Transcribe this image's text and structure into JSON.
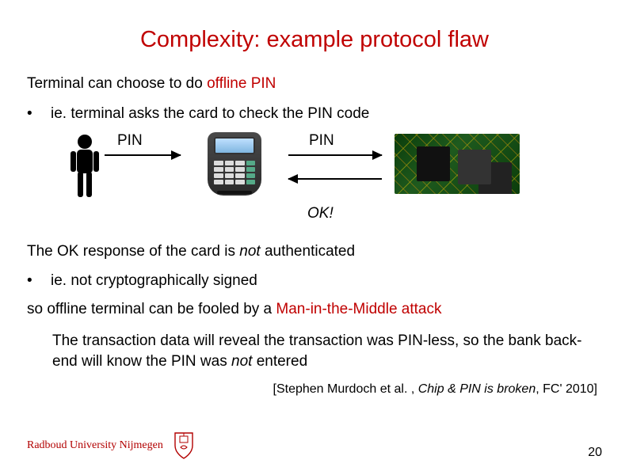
{
  "title": "Complexity: example protocol flaw",
  "line1_a": "Terminal can choose to do ",
  "line1_b": "offline PIN",
  "bullet1": "ie. terminal asks the card to check the PIN code",
  "diagram": {
    "pin_a": "PIN",
    "pin_b": "PIN",
    "ok": "OK!"
  },
  "line2_a": "The OK response of the card is ",
  "line2_not": "not",
  "line2_b": "  authenticated",
  "bullet2": "ie. not cryptographically signed",
  "line3_a": "so offline terminal can be fooled by a ",
  "line3_b": "Man-in-the-Middle attack",
  "line4_a": "The transaction data will reveal the transaction was PIN-less,          so the bank back-end will know the PIN was ",
  "line4_not": "not",
  "line4_b": "  entered",
  "citation_a": "[Stephen Murdoch et al. , ",
  "citation_b": "Chip & PIN is broken",
  "citation_c": ", FC' 2010]",
  "footer": {
    "university": "Radboud University Nijmegen",
    "page": "20"
  }
}
